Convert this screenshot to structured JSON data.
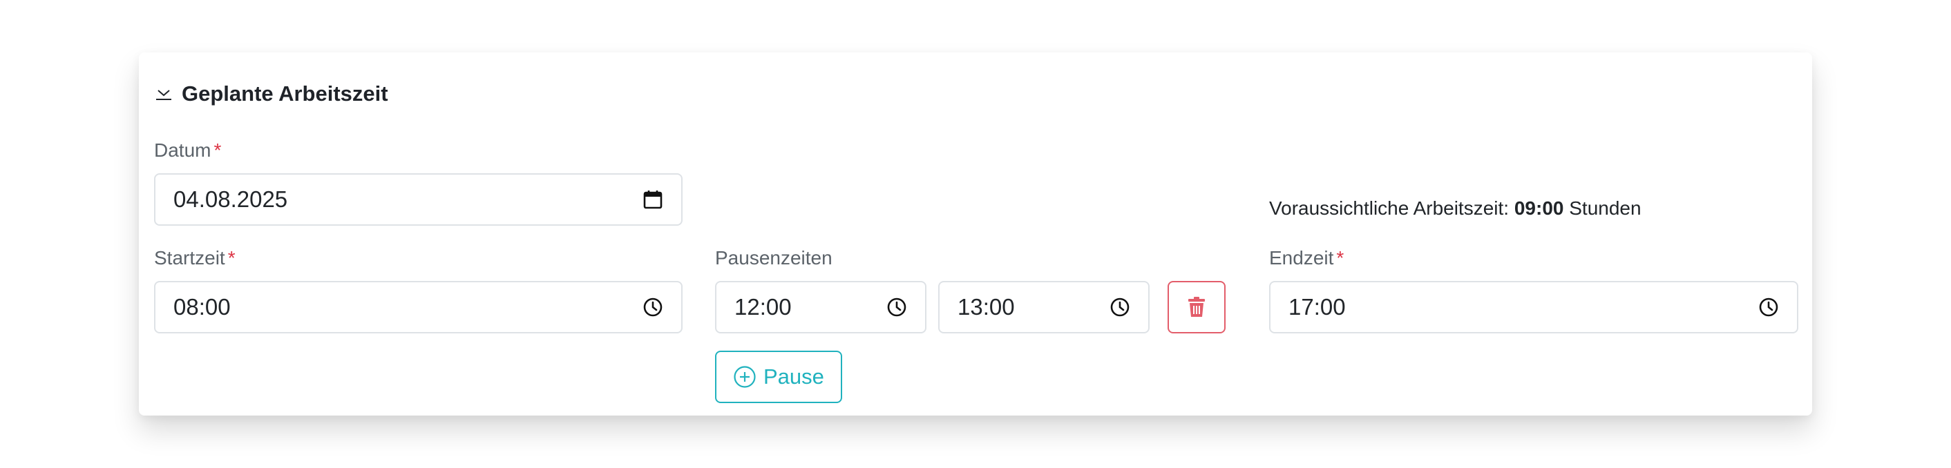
{
  "section": {
    "title": "Geplante Arbeitszeit",
    "collapse_icon": "chevron-down-icon"
  },
  "datum": {
    "label": "Datum",
    "required_mark": "*",
    "value": "04.08.2025",
    "icon": "calendar-icon"
  },
  "startzeit": {
    "label": "Startzeit",
    "required_mark": "*",
    "value": "08:00",
    "icon": "clock-icon"
  },
  "pausen": {
    "label": "Pausenzeiten",
    "items": [
      {
        "start": "12:00",
        "end": "13:00"
      }
    ],
    "delete_icon": "trash-icon",
    "add_label": "Pause",
    "add_icon": "plus-circle-icon"
  },
  "endzeit": {
    "label": "Endzeit",
    "required_mark": "*",
    "value": "17:00",
    "icon": "clock-icon"
  },
  "arbeitszeit": {
    "prefix": "Voraussichtliche Arbeitszeit:",
    "value": "09:00",
    "suffix": "Stunden"
  },
  "colors": {
    "required": "#dc3545",
    "accent": "#20b2be",
    "danger": "#e35d6a",
    "border": "#dee2e6",
    "label": "#5c636a"
  }
}
